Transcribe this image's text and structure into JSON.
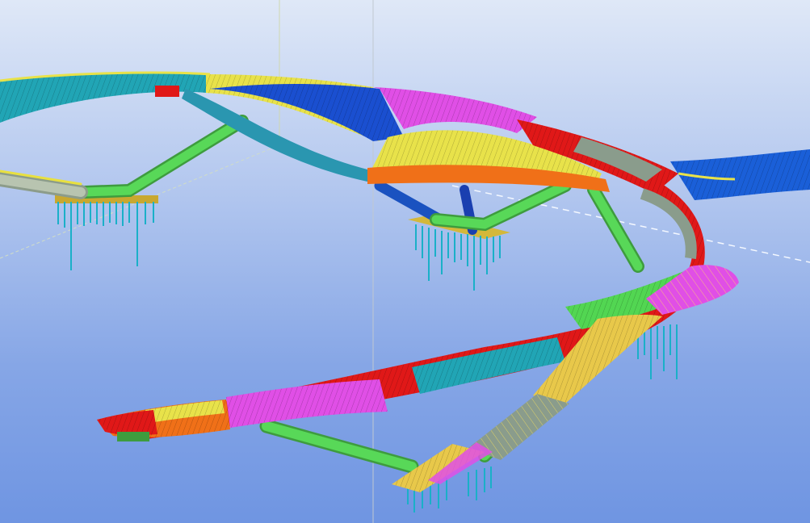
{
  "viewport": {
    "background_top": "#dfe8f7",
    "background_bottom": "#6f95e2",
    "view_mode": "3d-perspective"
  },
  "model": {
    "segment_colors": {
      "magenta": "#e04fe6",
      "teal": "#21a5b5",
      "yellow": "#e8e24a",
      "red": "#e01818",
      "blue": "#1a5fd8",
      "orange": "#f07018",
      "green": "#52d652",
      "gray": "#8a9c8c",
      "pile": "#1ab0c8"
    },
    "elements": [
      "upper-ring-deck",
      "lower-curved-deck",
      "branch-ramp",
      "east-outgoing-deck",
      "support-arch-left",
      "support-arch-right",
      "pier-group-left",
      "pier-group-center",
      "pier-group-right",
      "pier-group-bottom"
    ]
  },
  "guides": {
    "work_plane_color": "#ffffff",
    "axis_color": "#c8d0d8"
  }
}
